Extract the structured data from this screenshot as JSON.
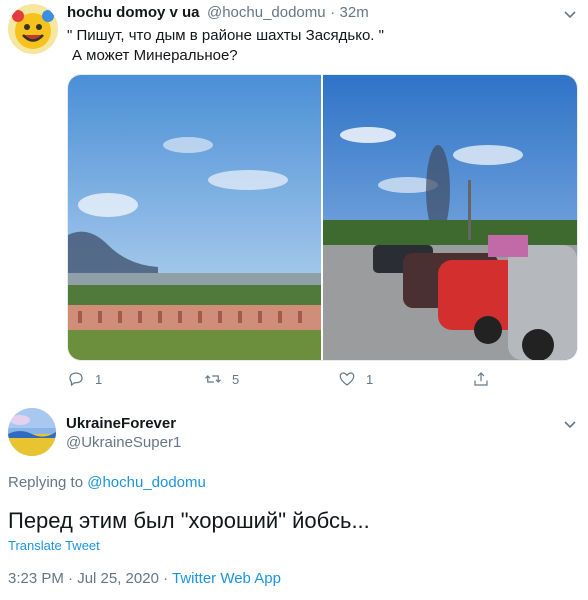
{
  "parent_tweet": {
    "display_name": "hochu domoy v ua",
    "handle": "@hochu_dodomu",
    "separator": "·",
    "time": "32m",
    "text_line1": "\" Пишут, что дым в районе шахты Засядько. \"",
    "text_line2": "А  может Минеральное?",
    "actions": {
      "reply_count": "1",
      "retweet_count": "5",
      "like_count": "1"
    }
  },
  "main_tweet": {
    "display_name": "UkraineForever",
    "handle": "@UkraineSuper1",
    "replying_prefix": "Replying to",
    "replying_handle": "@hochu_dodomu",
    "text": "Перед этим был \"хороший\" йобсь...",
    "translate_label": "Translate Tweet",
    "timestamp": "3:23 PM · Jul 25, 2020 · ",
    "source": "Twitter Web App"
  },
  "colors": {
    "link": "#1b95e0",
    "muted": "#657786",
    "text": "#14171a"
  },
  "icons": {
    "reply": "reply-icon",
    "retweet": "retweet-icon",
    "like": "heart-icon",
    "share": "share-icon",
    "more": "chevron-down-icon"
  }
}
